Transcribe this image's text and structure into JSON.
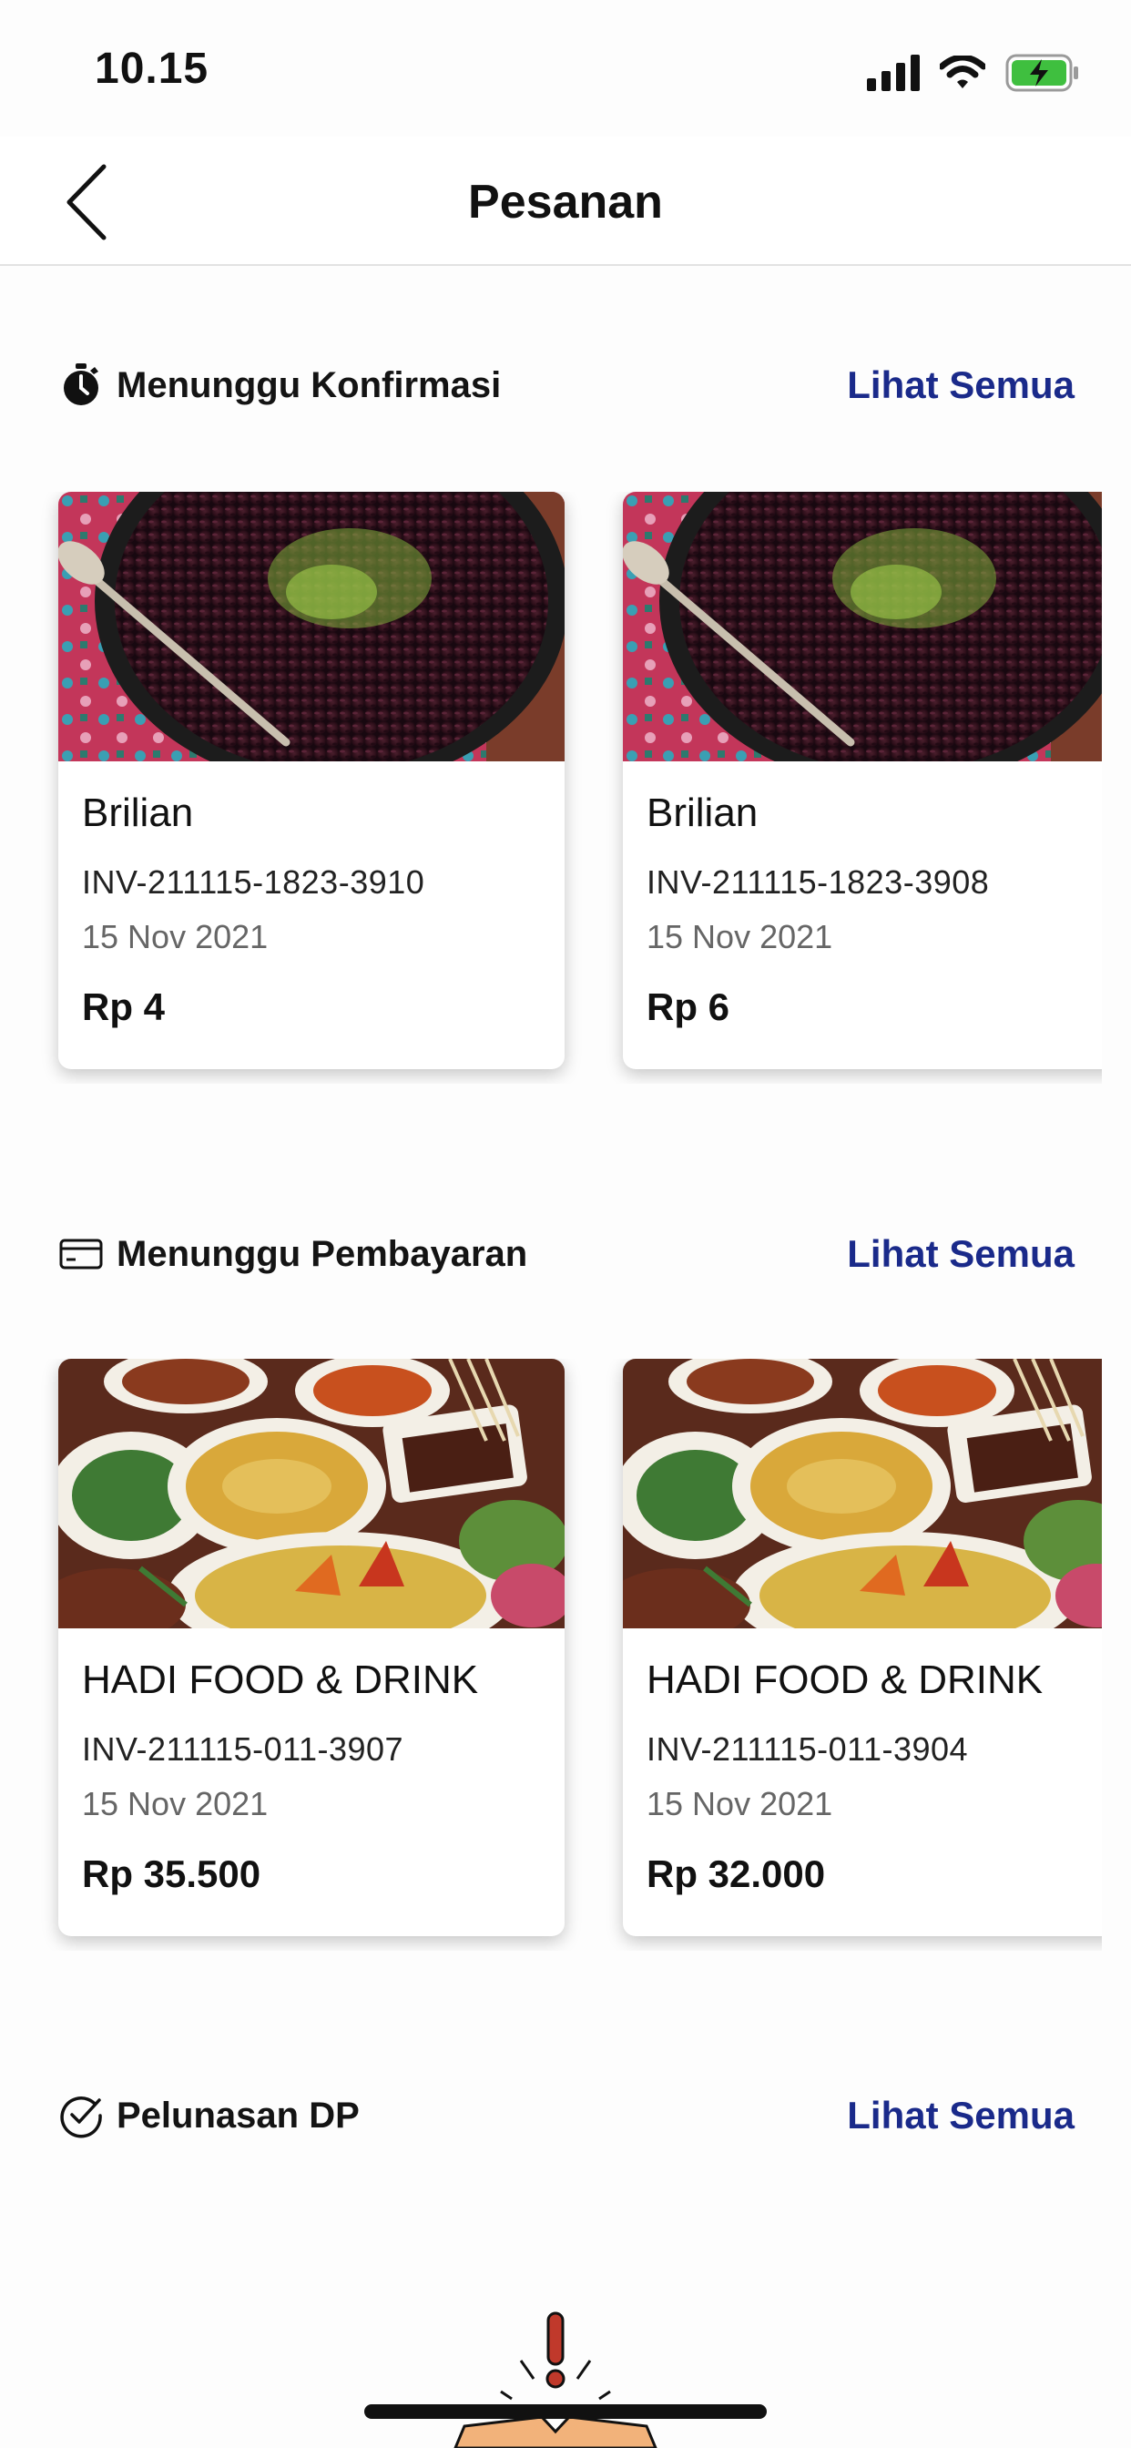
{
  "status_bar": {
    "time": "10.15"
  },
  "nav": {
    "title": "Pesanan"
  },
  "sections": {
    "konfirmasi": {
      "title": "Menunggu Konfirmasi",
      "see_all": "Lihat Semua",
      "icon": "stopwatch-icon",
      "orders": [
        {
          "name": "Brilian",
          "invoice": "INV-211115-1823-3910",
          "date": "15 Nov 2021",
          "price": "Rp 4",
          "image": "black-rice-dish"
        },
        {
          "name": "Brilian",
          "invoice": "INV-211115-1823-3908",
          "date": "15 Nov 2021",
          "price": "Rp 6",
          "image": "black-rice-dish"
        }
      ]
    },
    "pembayaran": {
      "title": "Menunggu Pembayaran",
      "see_all": "Lihat Semua",
      "icon": "credit-card-icon",
      "orders": [
        {
          "name": "HADI FOOD & DRINK",
          "invoice": "INV-211115-011-3907",
          "date": "15 Nov 2021",
          "price": "Rp 35.500",
          "image": "indonesian-feast"
        },
        {
          "name": "HADI FOOD & DRINK",
          "invoice": "INV-211115-011-3904",
          "date": "15 Nov 2021",
          "price": "Rp 32.000",
          "image": "indonesian-feast"
        }
      ]
    },
    "pelunasan": {
      "title": "Pelunasan DP",
      "see_all": "Lihat Semua",
      "icon": "check-circle-icon"
    }
  },
  "colors": {
    "link": "#1a2a8a",
    "battery": "#3fbf3f",
    "alert": "#c0392b"
  }
}
